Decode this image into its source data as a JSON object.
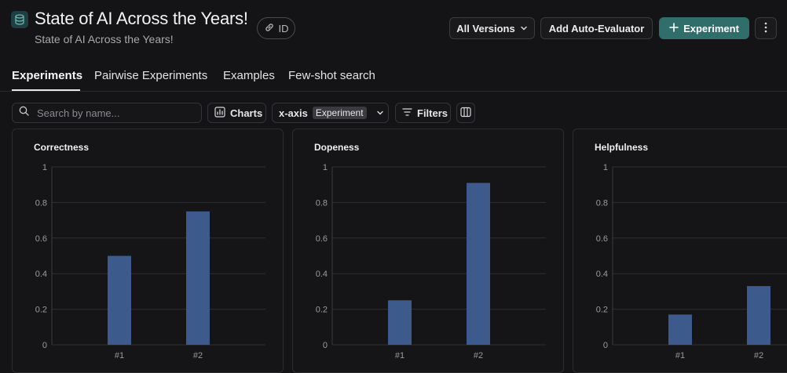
{
  "header": {
    "title": "State of AI Across the Years!",
    "subtitle": "State of AI Across the Years!",
    "id_label": "ID",
    "versions_label": "All Versions",
    "auto_evaluator_label": "Add Auto-Evaluator",
    "experiment_label": "Experiment"
  },
  "tabs": [
    {
      "label": "Experiments",
      "active": true
    },
    {
      "label": "Pairwise Experiments",
      "active": false
    },
    {
      "label": "Examples",
      "active": false
    },
    {
      "label": "Few-shot search",
      "active": false
    }
  ],
  "toolbar": {
    "search_placeholder": "Search by name...",
    "charts_label": "Charts",
    "xaxis_label": "x-axis",
    "xaxis_value": "Experiment",
    "filters_label": "Filters"
  },
  "colors": {
    "accent": "#2f6e6a",
    "bar": "#3d5a8c",
    "background": "#141416"
  },
  "icons": [
    "database-icon",
    "link-icon",
    "chevron-down-icon",
    "plus-icon",
    "more-vertical-icon",
    "search-icon",
    "chart-icon",
    "filter-icon",
    "columns-icon"
  ],
  "chart_data": [
    {
      "type": "bar",
      "title": "Correctness",
      "categories": [
        "#1",
        "#2"
      ],
      "values": [
        0.5,
        0.75
      ],
      "ylim": [
        0,
        1
      ],
      "yticks": [
        "0",
        "0.2",
        "0.4",
        "0.6",
        "0.8",
        "1"
      ],
      "grid": true
    },
    {
      "type": "bar",
      "title": "Dopeness",
      "categories": [
        "#1",
        "#2"
      ],
      "values": [
        0.25,
        0.91
      ],
      "ylim": [
        0,
        1
      ],
      "yticks": [
        "0",
        "0.2",
        "0.4",
        "0.6",
        "0.8",
        "1"
      ],
      "grid": true
    },
    {
      "type": "bar",
      "title": "Helpfulness",
      "categories": [
        "#1",
        "#2"
      ],
      "values": [
        0.17,
        0.33
      ],
      "ylim": [
        0,
        1
      ],
      "yticks": [
        "0",
        "0.2",
        "0.4",
        "0.6",
        "0.8",
        "1"
      ],
      "grid": true
    }
  ]
}
